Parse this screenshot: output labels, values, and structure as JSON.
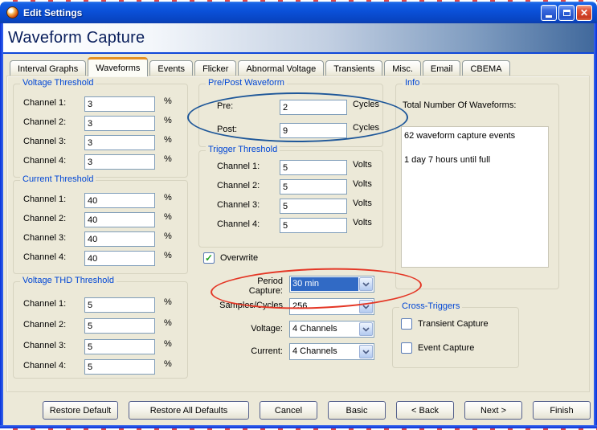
{
  "colors": {
    "titlebar_blue": "#0a50d8",
    "frame_blue": "#0831d9",
    "content_beige": "#ece9d8",
    "selection_blue": "#316ac5",
    "group_title_blue": "#0046d5",
    "active_tab_orange": "#e59124",
    "annotation_blue": "#1e5799",
    "annotation_red": "#e43625",
    "close_button_red": "#d03a20"
  },
  "titlebar": {
    "title": "Edit Settings",
    "close_glyph": "✕"
  },
  "header": {
    "title": "Waveform Capture"
  },
  "tabs": {
    "items": [
      {
        "label": "Interval Graphs"
      },
      {
        "label": "Waveforms",
        "active": true
      },
      {
        "label": "Events"
      },
      {
        "label": "Flicker"
      },
      {
        "label": "Abnormal Voltage"
      },
      {
        "label": "Transients"
      },
      {
        "label": "Misc."
      },
      {
        "label": "Email"
      },
      {
        "label": "CBEMA"
      }
    ]
  },
  "voltage_threshold": {
    "title": "Voltage Threshold",
    "unit": "%",
    "rows": [
      {
        "label": "Channel 1:",
        "value": "3"
      },
      {
        "label": "Channel 2:",
        "value": "3"
      },
      {
        "label": "Channel 3:",
        "value": "3"
      },
      {
        "label": "Channel 4:",
        "value": "3"
      }
    ]
  },
  "current_threshold": {
    "title": "Current Threshold",
    "unit": "%",
    "rows": [
      {
        "label": "Channel 1:",
        "value": "40"
      },
      {
        "label": "Channel 2:",
        "value": "40"
      },
      {
        "label": "Channel 3:",
        "value": "40"
      },
      {
        "label": "Channel 4:",
        "value": "40"
      }
    ]
  },
  "voltage_thd_threshold": {
    "title": "Voltage THD Threshold",
    "unit": "%",
    "rows": [
      {
        "label": "Channel 1:",
        "value": "5"
      },
      {
        "label": "Channel 2:",
        "value": "5"
      },
      {
        "label": "Channel 3:",
        "value": "5"
      },
      {
        "label": "Channel 4:",
        "value": "5"
      }
    ]
  },
  "pre_post_waveform": {
    "title": "Pre/Post Waveform",
    "unit": "Cycles",
    "rows": [
      {
        "label": "Pre:",
        "value": "2"
      },
      {
        "label": "Post:",
        "value": "9"
      }
    ]
  },
  "trigger_threshold": {
    "title": "Trigger Threshold",
    "unit": "Volts",
    "rows": [
      {
        "label": "Channel 1:",
        "value": "5"
      },
      {
        "label": "Channel 2:",
        "value": "5"
      },
      {
        "label": "Channel 3:",
        "value": "5"
      },
      {
        "label": "Channel 4:",
        "value": "5"
      }
    ]
  },
  "overwrite": {
    "label": "Overwrite",
    "checked": true
  },
  "capture_settings": {
    "period_capture": {
      "label": "Period Capture:",
      "value": "30 min",
      "selected": true
    },
    "samples_cycles": {
      "label": "Samples/Cycles",
      "value": "256"
    },
    "voltage": {
      "label": "Voltage:",
      "value": "4 Channels"
    },
    "current": {
      "label": "Current:",
      "value": "4 Channels"
    }
  },
  "info": {
    "title": "Info",
    "label": "Total Number Of Waveforms:",
    "lines": [
      "62 waveform capture events",
      "1 day 7 hours until full"
    ]
  },
  "cross_triggers": {
    "title": "Cross-Triggers",
    "checkboxes": [
      {
        "label": "Transient Capture",
        "checked": false
      },
      {
        "label": "Event Capture",
        "checked": false
      }
    ]
  },
  "footer_buttons": [
    "Restore Default",
    "Restore All Defaults",
    "Cancel",
    "Basic",
    "< Back",
    "Next >",
    "Finish"
  ]
}
